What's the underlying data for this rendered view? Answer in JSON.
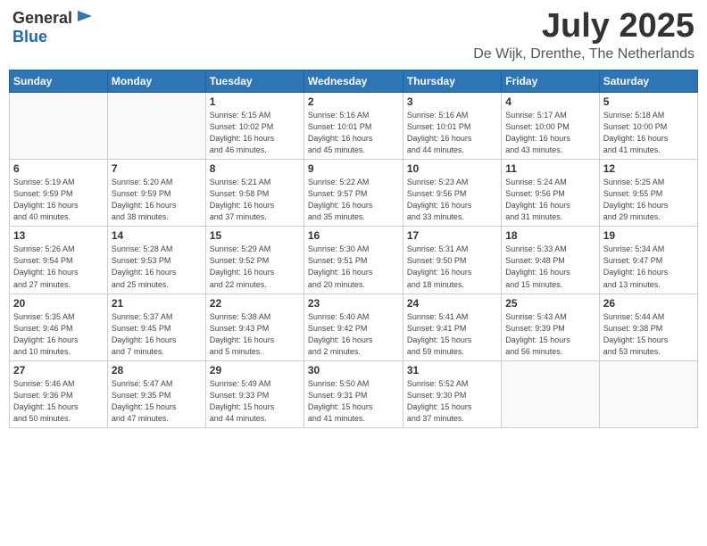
{
  "header": {
    "logo_general": "General",
    "logo_blue": "Blue",
    "month": "July 2025",
    "location": "De Wijk, Drenthe, The Netherlands"
  },
  "weekdays": [
    "Sunday",
    "Monday",
    "Tuesday",
    "Wednesday",
    "Thursday",
    "Friday",
    "Saturday"
  ],
  "weeks": [
    [
      {
        "day": "",
        "detail": ""
      },
      {
        "day": "",
        "detail": ""
      },
      {
        "day": "1",
        "detail": "Sunrise: 5:15 AM\nSunset: 10:02 PM\nDaylight: 16 hours\nand 46 minutes."
      },
      {
        "day": "2",
        "detail": "Sunrise: 5:16 AM\nSunset: 10:01 PM\nDaylight: 16 hours\nand 45 minutes."
      },
      {
        "day": "3",
        "detail": "Sunrise: 5:16 AM\nSunset: 10:01 PM\nDaylight: 16 hours\nand 44 minutes."
      },
      {
        "day": "4",
        "detail": "Sunrise: 5:17 AM\nSunset: 10:00 PM\nDaylight: 16 hours\nand 43 minutes."
      },
      {
        "day": "5",
        "detail": "Sunrise: 5:18 AM\nSunset: 10:00 PM\nDaylight: 16 hours\nand 41 minutes."
      }
    ],
    [
      {
        "day": "6",
        "detail": "Sunrise: 5:19 AM\nSunset: 9:59 PM\nDaylight: 16 hours\nand 40 minutes."
      },
      {
        "day": "7",
        "detail": "Sunrise: 5:20 AM\nSunset: 9:59 PM\nDaylight: 16 hours\nand 38 minutes."
      },
      {
        "day": "8",
        "detail": "Sunrise: 5:21 AM\nSunset: 9:58 PM\nDaylight: 16 hours\nand 37 minutes."
      },
      {
        "day": "9",
        "detail": "Sunrise: 5:22 AM\nSunset: 9:57 PM\nDaylight: 16 hours\nand 35 minutes."
      },
      {
        "day": "10",
        "detail": "Sunrise: 5:23 AM\nSunset: 9:56 PM\nDaylight: 16 hours\nand 33 minutes."
      },
      {
        "day": "11",
        "detail": "Sunrise: 5:24 AM\nSunset: 9:56 PM\nDaylight: 16 hours\nand 31 minutes."
      },
      {
        "day": "12",
        "detail": "Sunrise: 5:25 AM\nSunset: 9:55 PM\nDaylight: 16 hours\nand 29 minutes."
      }
    ],
    [
      {
        "day": "13",
        "detail": "Sunrise: 5:26 AM\nSunset: 9:54 PM\nDaylight: 16 hours\nand 27 minutes."
      },
      {
        "day": "14",
        "detail": "Sunrise: 5:28 AM\nSunset: 9:53 PM\nDaylight: 16 hours\nand 25 minutes."
      },
      {
        "day": "15",
        "detail": "Sunrise: 5:29 AM\nSunset: 9:52 PM\nDaylight: 16 hours\nand 22 minutes."
      },
      {
        "day": "16",
        "detail": "Sunrise: 5:30 AM\nSunset: 9:51 PM\nDaylight: 16 hours\nand 20 minutes."
      },
      {
        "day": "17",
        "detail": "Sunrise: 5:31 AM\nSunset: 9:50 PM\nDaylight: 16 hours\nand 18 minutes."
      },
      {
        "day": "18",
        "detail": "Sunrise: 5:33 AM\nSunset: 9:48 PM\nDaylight: 16 hours\nand 15 minutes."
      },
      {
        "day": "19",
        "detail": "Sunrise: 5:34 AM\nSunset: 9:47 PM\nDaylight: 16 hours\nand 13 minutes."
      }
    ],
    [
      {
        "day": "20",
        "detail": "Sunrise: 5:35 AM\nSunset: 9:46 PM\nDaylight: 16 hours\nand 10 minutes."
      },
      {
        "day": "21",
        "detail": "Sunrise: 5:37 AM\nSunset: 9:45 PM\nDaylight: 16 hours\nand 7 minutes."
      },
      {
        "day": "22",
        "detail": "Sunrise: 5:38 AM\nSunset: 9:43 PM\nDaylight: 16 hours\nand 5 minutes."
      },
      {
        "day": "23",
        "detail": "Sunrise: 5:40 AM\nSunset: 9:42 PM\nDaylight: 16 hours\nand 2 minutes."
      },
      {
        "day": "24",
        "detail": "Sunrise: 5:41 AM\nSunset: 9:41 PM\nDaylight: 15 hours\nand 59 minutes."
      },
      {
        "day": "25",
        "detail": "Sunrise: 5:43 AM\nSunset: 9:39 PM\nDaylight: 15 hours\nand 56 minutes."
      },
      {
        "day": "26",
        "detail": "Sunrise: 5:44 AM\nSunset: 9:38 PM\nDaylight: 15 hours\nand 53 minutes."
      }
    ],
    [
      {
        "day": "27",
        "detail": "Sunrise: 5:46 AM\nSunset: 9:36 PM\nDaylight: 15 hours\nand 50 minutes."
      },
      {
        "day": "28",
        "detail": "Sunrise: 5:47 AM\nSunset: 9:35 PM\nDaylight: 15 hours\nand 47 minutes."
      },
      {
        "day": "29",
        "detail": "Sunrise: 5:49 AM\nSunset: 9:33 PM\nDaylight: 15 hours\nand 44 minutes."
      },
      {
        "day": "30",
        "detail": "Sunrise: 5:50 AM\nSunset: 9:31 PM\nDaylight: 15 hours\nand 41 minutes."
      },
      {
        "day": "31",
        "detail": "Sunrise: 5:52 AM\nSunset: 9:30 PM\nDaylight: 15 hours\nand 37 minutes."
      },
      {
        "day": "",
        "detail": ""
      },
      {
        "day": "",
        "detail": ""
      }
    ]
  ]
}
